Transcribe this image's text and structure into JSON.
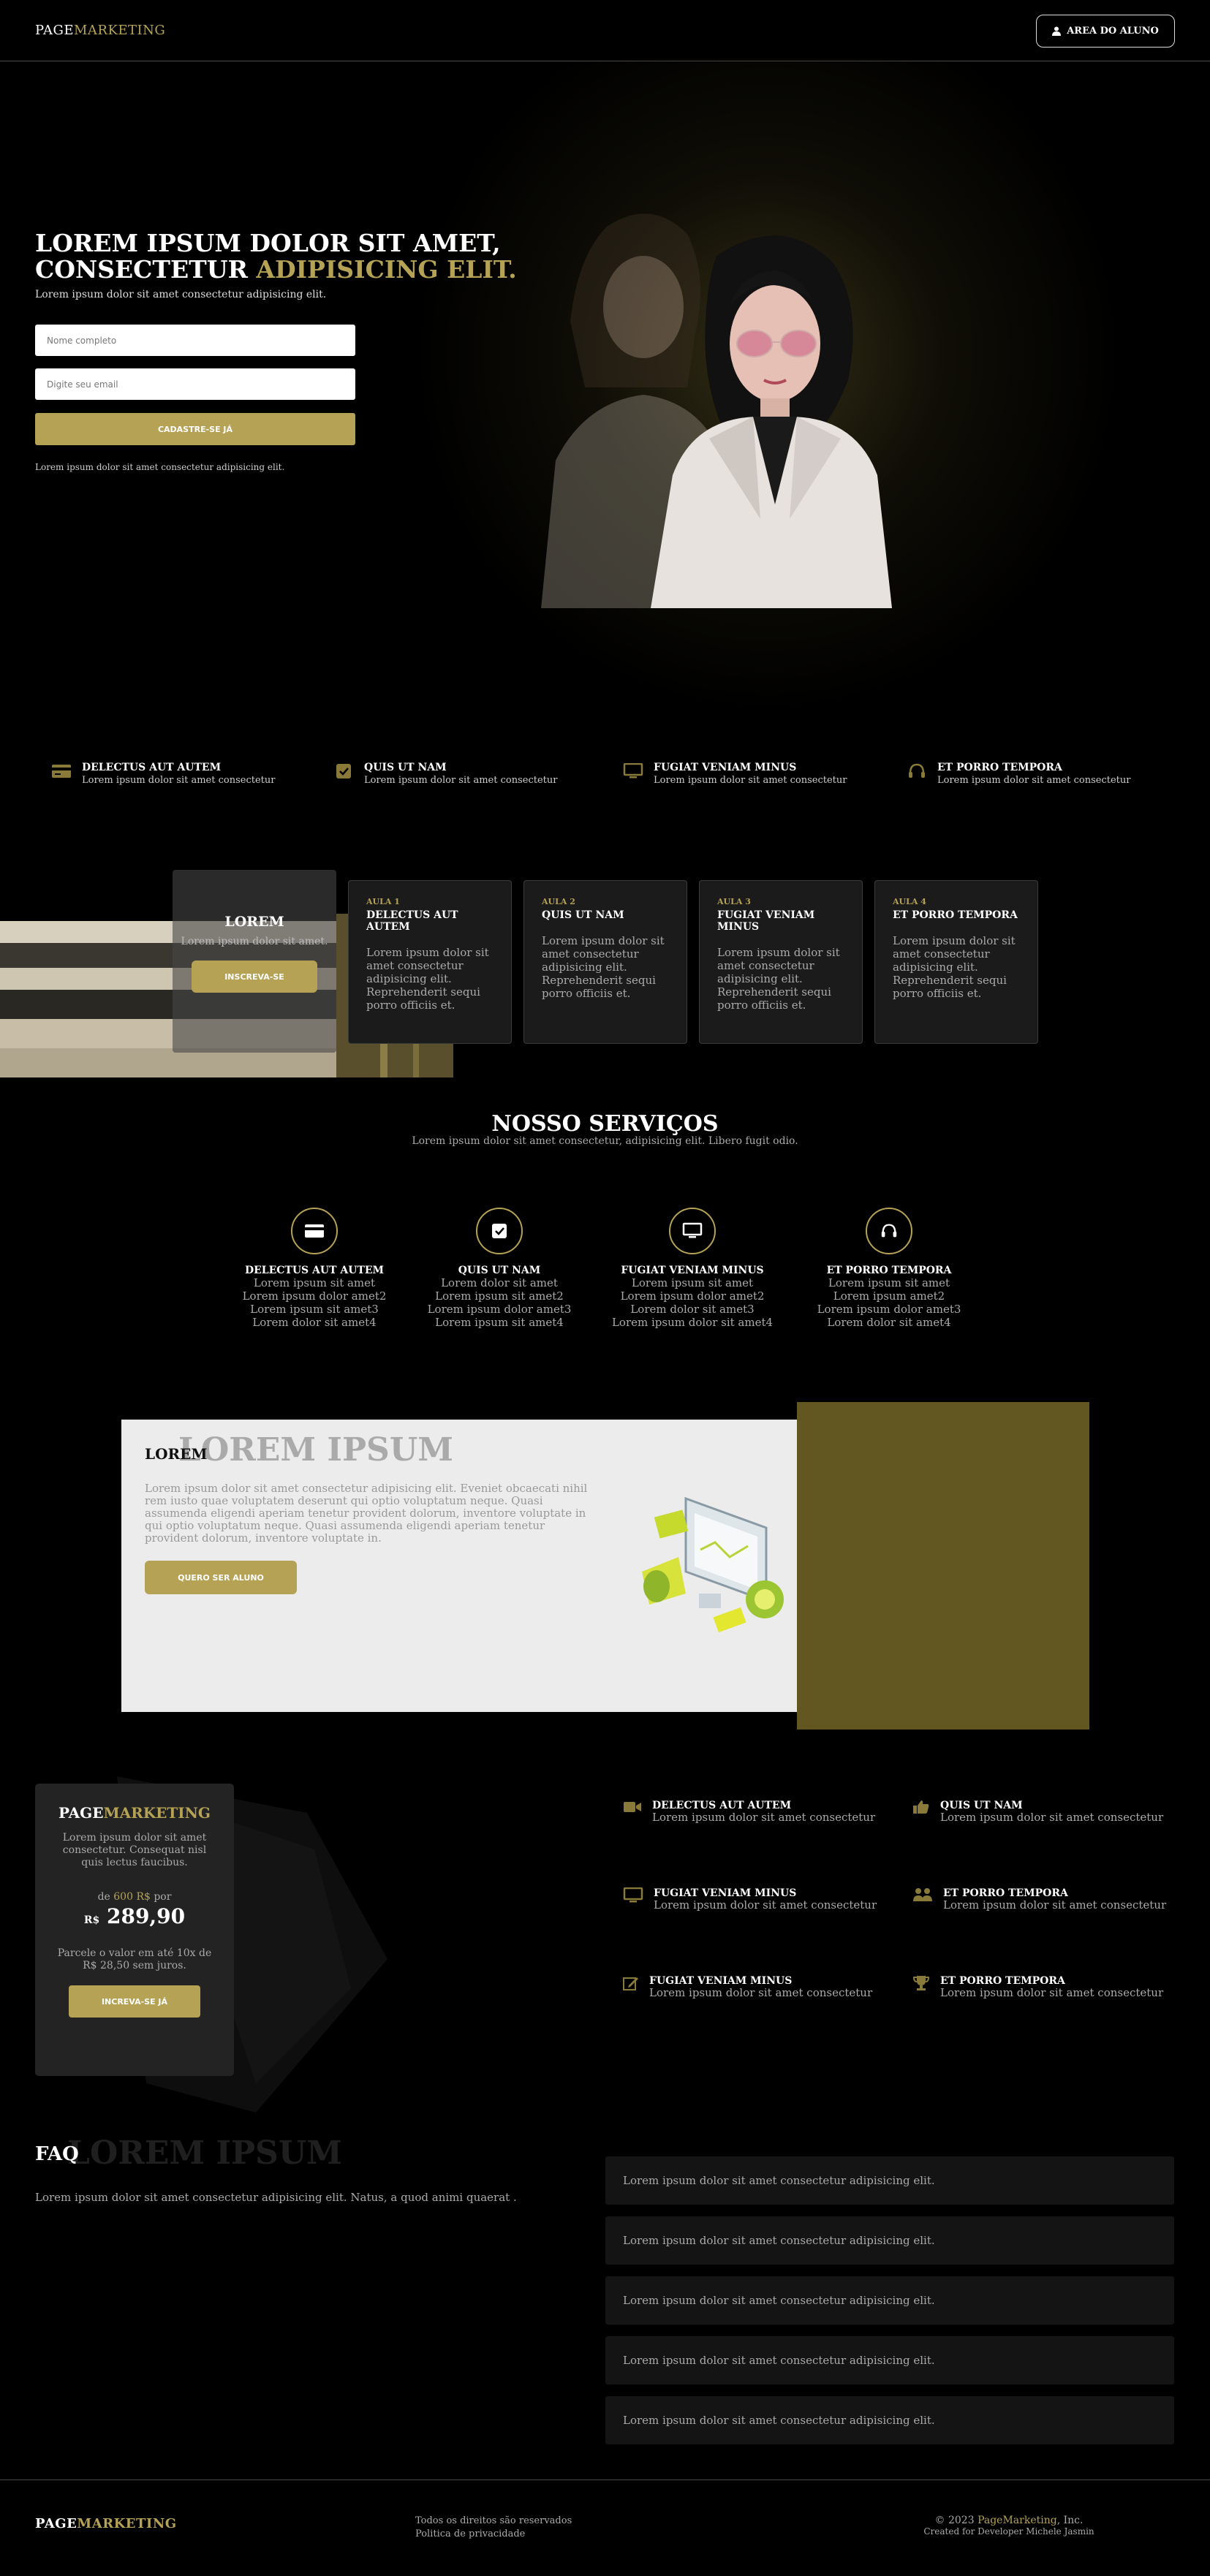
{
  "header": {
    "brand_a": "PAGE",
    "brand_b": "MARKETING",
    "area_btn": "AREA DO ALUNO"
  },
  "hero": {
    "title_line1": "LOREM IPSUM DOLOR SIT AMET,",
    "title_line2_a": "CONSECTETUR ",
    "title_line2_b": "ADIPISICING ELIT.",
    "subtitle": "Lorem ipsum dolor sit amet consectetur adipisicing elit.",
    "name_placeholder": "Nome completo",
    "email_placeholder": "Digite seu email",
    "cta": "CADASTRE-SE JÁ",
    "footnote": "Lorem ipsum dolor sit amet consectetur adipisicing elit."
  },
  "features": [
    {
      "icon": "credit-card-icon",
      "title": "DELECTUS AUT AUTEM",
      "desc": "Lorem ipsum dolor sit amet consectetur"
    },
    {
      "icon": "checkbox-icon",
      "title": "QUIS UT NAM",
      "desc": "Lorem ipsum dolor sit amet consectetur"
    },
    {
      "icon": "monitor-icon",
      "title": "FUGIAT VENIAM MINUS",
      "desc": "Lorem ipsum dolor sit amet consectetur"
    },
    {
      "icon": "headset-icon",
      "title": "ET PORRO TEMPORA",
      "desc": "Lorem ipsum dolor sit amet consectetur"
    }
  ],
  "classes": {
    "card_title": "LOREM",
    "card_desc": "Lorem ipsum dolor sit amet.",
    "card_btn": "INSCREVA-SE",
    "lessons": [
      {
        "num": "AULA 1",
        "title": "DELECTUS AUT AUTEM",
        "desc": "Lorem ipsum dolor sit amet consectetur adipisicing elit. Reprehenderit sequi porro officiis et."
      },
      {
        "num": "AULA 2",
        "title": "QUIS UT NAM",
        "desc": "Lorem ipsum dolor sit amet consectetur adipisicing elit. Reprehenderit sequi porro officiis et."
      },
      {
        "num": "AULA 3",
        "title": "FUGIAT VENIAM MINUS",
        "desc": "Lorem ipsum dolor sit amet consectetur adipisicing elit. Reprehenderit sequi porro officiis et."
      },
      {
        "num": "AULA 4",
        "title": "ET PORRO TEMPORA",
        "desc": "Lorem ipsum dolor sit amet consectetur adipisicing elit. Reprehenderit sequi porro officiis et."
      }
    ]
  },
  "services": {
    "title": "NOSSO SERVIÇOS",
    "subtitle": "Lorem ipsum dolor sit amet consectetur, adipisicing elit. Libero fugit odio.",
    "items": [
      {
        "icon": "credit-card-icon",
        "title": "DELECTUS AUT AUTEM",
        "lines": [
          "Lorem ipsum sit amet",
          "Lorem ipsum dolor amet2",
          "Lorem ipsum sit amet3",
          "Lorem dolor sit amet4"
        ]
      },
      {
        "icon": "checkbox-icon",
        "title": "QUIS UT NAM",
        "lines": [
          "Lorem dolor sit amet",
          "Lorem ipsum sit amet2",
          "Lorem ipsum dolor amet3",
          "Lorem ipsum sit amet4"
        ]
      },
      {
        "icon": "monitor-icon",
        "title": "FUGIAT VENIAM MINUS",
        "lines": [
          "Lorem ipsum sit amet",
          "Lorem ipsum dolor amet2",
          "Lorem dolor sit amet3",
          "Lorem ipsum dolor sit amet4"
        ]
      },
      {
        "icon": "headset-icon",
        "title": "ET PORRO TEMPORA",
        "lines": [
          "Lorem ipsum sit amet",
          "Lorem ipsum amet2",
          "Lorem ipsum dolor amet3",
          "Lorem dolor sit amet4"
        ]
      }
    ]
  },
  "promo": {
    "heading": "LOREM",
    "big": "LOREM IPSUM",
    "text": "Lorem ipsum dolor sit amet consectetur adipisicing elit. Eveniet obcaecati nihil rem iusto quae voluptatem deserunt qui optio voluptatum neque. Quasi assumenda eligendi aperiam tenetur provident dolorum, inventore voluptate in qui optio voluptatum neque. Quasi assumenda eligendi aperiam tenetur provident dolorum, inventore voluptate in.",
    "btn": "QUERO SER ALUNO"
  },
  "pricing": {
    "brand_a": "PAGE",
    "brand_b": "MARKETING",
    "desc": "Lorem ipsum dolor sit amet consectetur. Consequat nisl quis lectus faucibus.",
    "from_a": "de ",
    "from_old": "600 R$",
    "from_b": " por",
    "currency": "R$",
    "price": "289,90",
    "installments": "Parcele o valor em até 10x de R$ 28,50 sem juros.",
    "btn": "INCREVA-SE JÁ"
  },
  "benefits": [
    {
      "icon": "video-camera-icon",
      "title": "DELECTUS AUT AUTEM",
      "desc": "Lorem ipsum dolor sit amet consectetur"
    },
    {
      "icon": "thumbs-up-icon",
      "title": "QUIS UT NAM",
      "desc": "Lorem ipsum dolor sit amet consectetur"
    },
    {
      "icon": "monitor-icon",
      "title": "FUGIAT VENIAM MINUS",
      "desc": "Lorem ipsum dolor sit amet consectetur"
    },
    {
      "icon": "users-icon",
      "title": "ET PORRO TEMPORA",
      "desc": "Lorem ipsum dolor sit amet consectetur"
    },
    {
      "icon": "edit-icon",
      "title": "FUGIAT VENIAM MINUS",
      "desc": "Lorem ipsum dolor sit amet consectetur"
    },
    {
      "icon": "trophy-icon",
      "title": "ET PORRO TEMPORA",
      "desc": "Lorem ipsum dolor sit amet consectetur"
    }
  ],
  "faq": {
    "heading": "FAQ",
    "big": "LOREM IPSUM",
    "text": "Lorem ipsum dolor sit amet consectetur adipisicing elit. Natus, a quod animi quaerat .",
    "items": [
      "Lorem ipsum dolor sit amet consectetur adipisicing elit.",
      "Lorem ipsum dolor sit amet consectetur adipisicing elit.",
      "Lorem ipsum dolor sit amet consectetur adipisicing elit.",
      "Lorem ipsum dolor sit amet consectetur adipisicing elit.",
      "Lorem ipsum dolor sit amet consectetur adipisicing elit."
    ]
  },
  "footer": {
    "brand_a": "PAGE",
    "brand_b": "MARKETING",
    "rights": "Todos os direitos são reservados",
    "privacy": "Politica de privacidade",
    "copy_a": "© 2023 ",
    "copy_b": "PageMarketing",
    "copy_c": ", Inc.",
    "credit": "Created for Developer Michele Jasmin"
  },
  "colors": {
    "accent": "#b5a255",
    "promo_gold": "#635721",
    "background": "#000000"
  }
}
